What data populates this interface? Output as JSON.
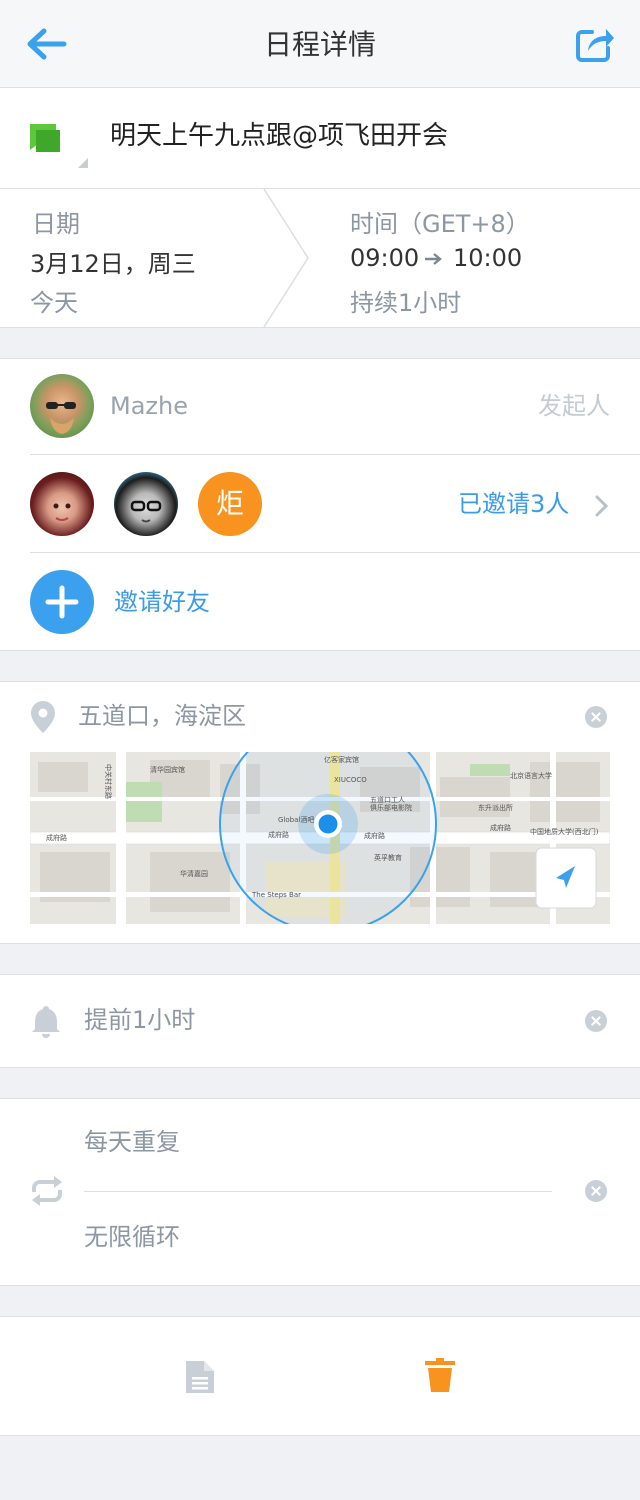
{
  "nav": {
    "title": "日程详情"
  },
  "event": {
    "title": "明天上午九点跟@项飞田开会"
  },
  "datetime": {
    "date_label": "日期",
    "date_value": "3月12日，周三",
    "date_sub": "今天",
    "time_label": "时间（GET+8）",
    "time_start": "09:00",
    "time_end": "10:00",
    "duration": "持续1小时"
  },
  "people": {
    "organizer": {
      "name": "Mazhe",
      "role": "发起人"
    },
    "invitees": [
      {
        "type": "photo"
      },
      {
        "type": "photo"
      },
      {
        "type": "initial",
        "initial": "炬"
      }
    ],
    "invited_count": "已邀请3人",
    "invite_label": "邀请好友"
  },
  "location": {
    "text": "五道口，海淀区",
    "map_labels": [
      "成府路",
      "成府路",
      "成府路",
      "中关村东路",
      "Global酒吧",
      "The Steps Bar",
      "华清嘉园",
      "清华园宾馆",
      "五道口工人俱乐部电影院",
      "北京语言大学",
      "东升派出所",
      "亿客家宾馆",
      "XIUCOCO",
      "英孚教育",
      "中国地质大学(西北门)"
    ]
  },
  "reminder": {
    "text": "提前1小时"
  },
  "repeat": {
    "frequency": "每天重复",
    "end": "无限循环"
  },
  "colors": {
    "accent": "#3ba1ee",
    "orange": "#f7931e",
    "flag": "#5cc83b",
    "background": "#eff1f4"
  }
}
